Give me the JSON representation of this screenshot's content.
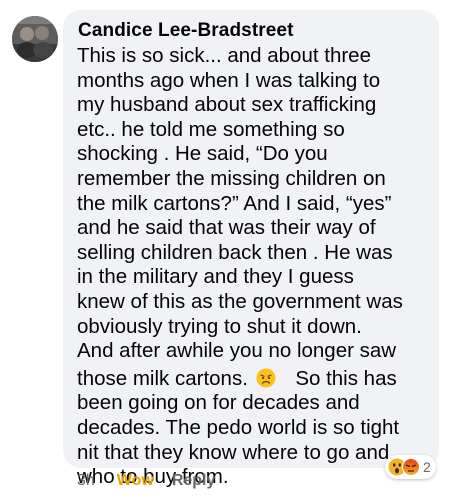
{
  "comment": {
    "author": "Candice Lee-Bradstreet",
    "lines_before_emoji": [
      "This is so sick... and about three",
      "months ago when I was talking to",
      "my husband about sex trafficking",
      "etc.. he told me something so",
      "shocking .  He said, “Do you",
      "remember the missing children on",
      "the milk cartons?” And I said, “yes”",
      "and he said that was their way of",
      "selling children back then . He was",
      "in the military and they I guess",
      "knew of this as the government was",
      "obviously trying to shut it down.",
      "And after awhile you no longer saw"
    ],
    "emoji_line_before": "those milk cartons.",
    "emoji_line_after": "So this has",
    "inline_emoji": "disappointed-face-icon",
    "lines_after_emoji": [
      "been going on for decades and",
      "decades. The pedo world is so tight",
      "nit that they know where to go and",
      "who to buy from."
    ]
  },
  "actions": {
    "time": "3h",
    "reaction_label": "Wow",
    "reply_label": "Reply"
  },
  "reactions": {
    "icons": [
      "wow-reaction-icon",
      "angry-reaction-icon"
    ],
    "count": "2"
  },
  "colors": {
    "bubble": "#f0f2f5",
    "text": "#050505",
    "muted": "#65676b",
    "wow_accent": "#e6a200",
    "angry": "#e9710f"
  }
}
